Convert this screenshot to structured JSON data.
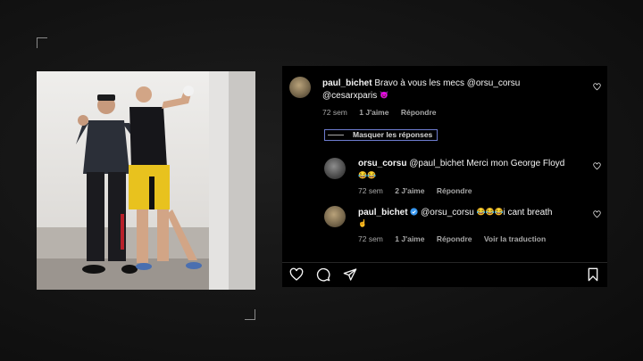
{
  "post": {
    "image_alt_icon": "photo-two-fighters"
  },
  "comments": [
    {
      "username": "paul_bichet",
      "text_line1": "Bravo à vous les mecs @orsu_corsu",
      "text_line2": "@cesarxparis",
      "emoji_line2": "😈",
      "time": "72 sem",
      "likes": "1 J'aime",
      "reply": "Répondre"
    }
  ],
  "hide_replies_label": "Masquer les réponses",
  "replies": [
    {
      "username": "orsu_corsu",
      "text_line1": "@paul_bichet Merci mon George Floyd",
      "emoji_line2": "😂😂",
      "time": "72 sem",
      "likes": "2 J'aime",
      "reply": "Répondre"
    },
    {
      "username": "paul_bichet",
      "verified_icon": "verified-badge-icon",
      "text_line1_mention": "@orsu_corsu",
      "emoji_line1": "😂😂😂",
      "text_line1_tail": "i cant breath",
      "emoji_line2": "☝️",
      "time": "72 sem",
      "likes": "1 J'aime",
      "reply": "Répondre",
      "translate": "Voir la traduction"
    }
  ],
  "actions": [
    "heart-icon",
    "comment-icon",
    "share-icon",
    "bookmark-icon"
  ],
  "colors": {
    "panel": "#000000",
    "accent_verified": "#3897f0",
    "meta_text": "#a8a8a8"
  }
}
